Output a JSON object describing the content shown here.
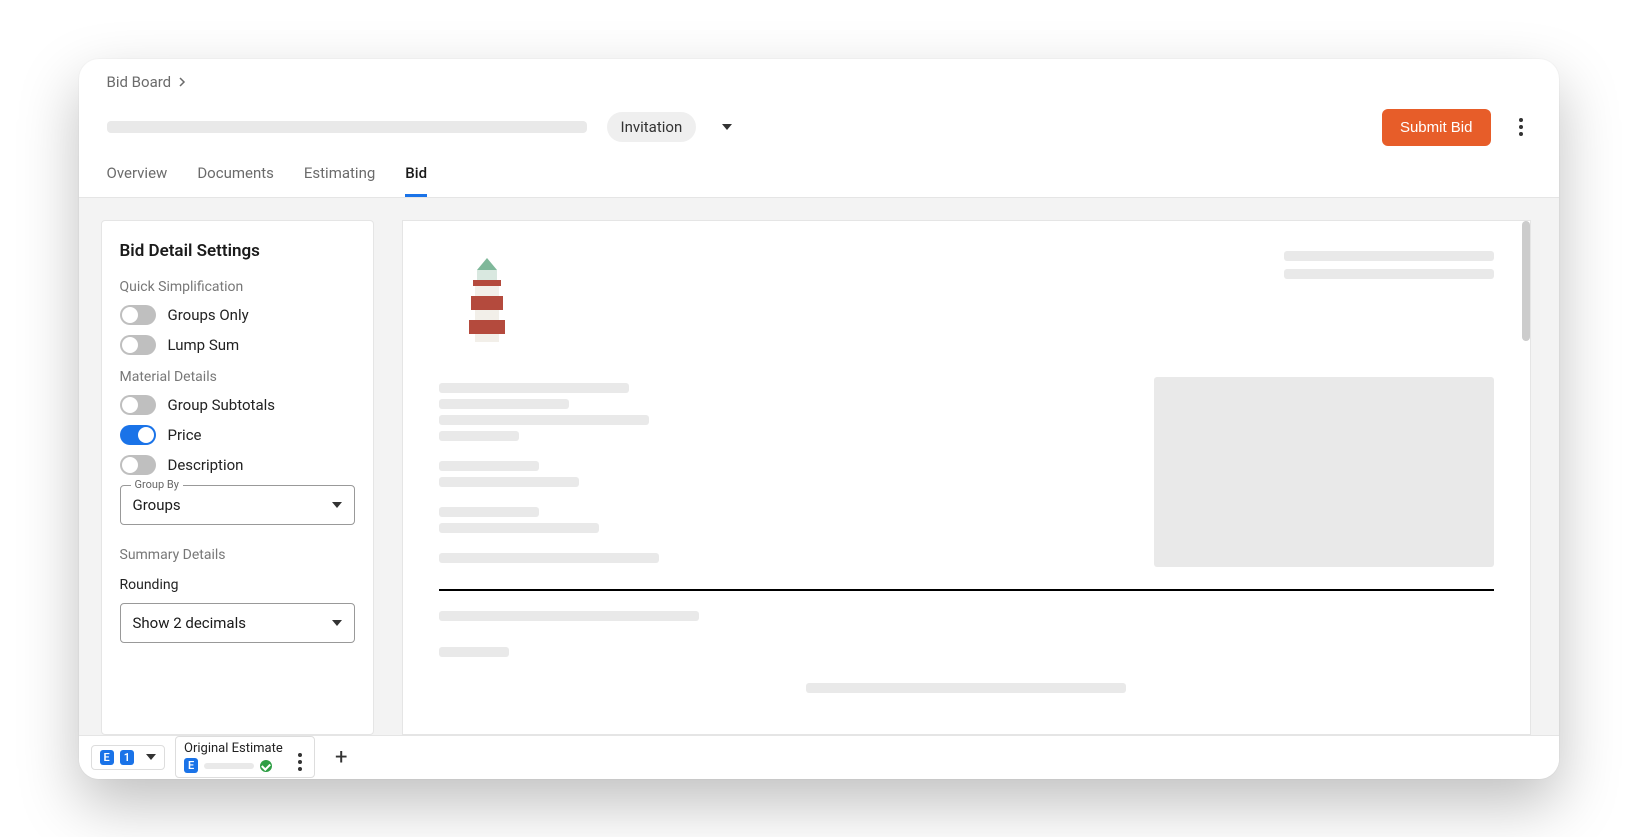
{
  "breadcrumb": {
    "label": "Bid Board"
  },
  "status": {
    "label": "Invitation"
  },
  "actions": {
    "submit": "Submit Bid"
  },
  "tabs": [
    {
      "label": "Overview",
      "active": false
    },
    {
      "label": "Documents",
      "active": false
    },
    {
      "label": "Estimating",
      "active": false
    },
    {
      "label": "Bid",
      "active": true
    }
  ],
  "sidebar": {
    "title": "Bid Detail Settings",
    "sections": {
      "quick_simplification": {
        "label": "Quick Simplification",
        "toggles": [
          {
            "label": "Groups Only",
            "on": false
          },
          {
            "label": "Lump Sum",
            "on": false
          }
        ]
      },
      "material_details": {
        "label": "Material Details",
        "toggles": [
          {
            "label": "Group Subtotals",
            "on": false
          },
          {
            "label": "Price",
            "on": true
          },
          {
            "label": "Description",
            "on": false
          }
        ],
        "group_by": {
          "float_label": "Group By",
          "value": "Groups"
        }
      },
      "summary_details": {
        "label": "Summary Details",
        "rounding": {
          "float_label": "Rounding",
          "value": "Show 2 decimals"
        }
      }
    }
  },
  "footer": {
    "est_count_badge": {
      "letter": "E",
      "number": "1"
    },
    "estimate_tab": {
      "title": "Original Estimate",
      "chip": "E"
    }
  }
}
